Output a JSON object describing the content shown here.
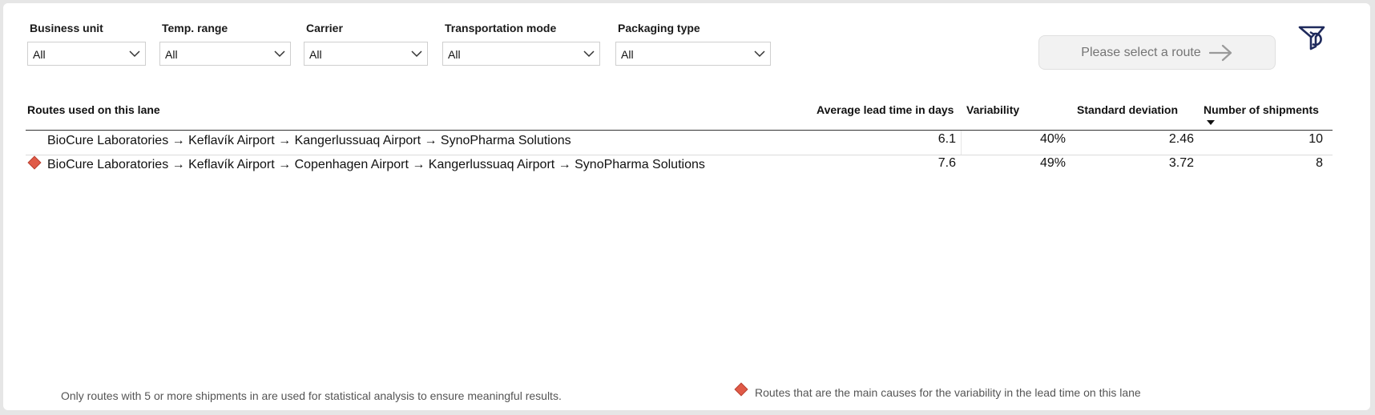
{
  "filters": [
    {
      "label": "Business unit",
      "value": "All"
    },
    {
      "label": "Temp. range",
      "value": "All"
    },
    {
      "label": "Carrier",
      "value": "All"
    },
    {
      "label": "Transportation mode",
      "value": "All"
    },
    {
      "label": "Packaging type",
      "value": "All"
    }
  ],
  "route_button": {
    "label": "Please select a route",
    "icon": "arrow-right-icon"
  },
  "reset_icon": "reset-filter-icon",
  "table": {
    "columns": [
      "Routes used on this lane",
      "Average lead time in days",
      "Variability",
      "Standard deviation",
      "Number of shipments"
    ],
    "sorted_column": "Number of shipments",
    "rows": [
      {
        "flag": false,
        "route": "BioCure Laboratories → Keflavík Airport → Kangerlussuaq Airport → SynoPharma Solutions",
        "avg_lead_time": "6.1",
        "variability": "40%",
        "std_dev": "2.46",
        "shipments": "10"
      },
      {
        "flag": true,
        "route": "BioCure Laboratories → Keflavík Airport → Copenhagen Airport → Kangerlussuaq Airport → SynoPharma Solutions",
        "avg_lead_time": "7.6",
        "variability": "49%",
        "std_dev": "3.72",
        "shipments": "8"
      }
    ]
  },
  "footer": {
    "note": "Only routes with 5 or more shipments in are used for statistical analysis to ensure meaningful results.",
    "legend": "Routes that are the main causes for the variability in the lead time on this lane",
    "legend_color": "#e05a47"
  }
}
